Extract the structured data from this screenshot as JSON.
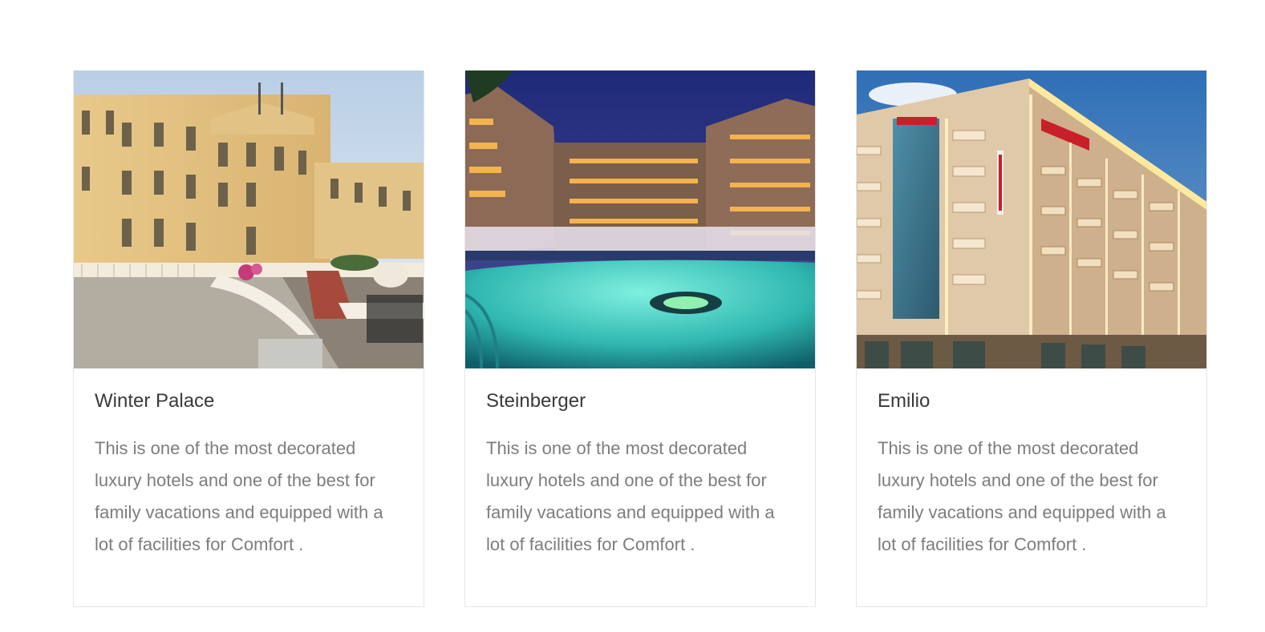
{
  "hotels": [
    {
      "name": "Winter Palace",
      "description": "This is one of the most decorated luxury hotels and one of the best for family vacations and equipped with a lot of facilities for Comfort ."
    },
    {
      "name": "Steinberger",
      "description": "This is one of the most decorated luxury hotels and one of the best for family vacations and equipped with a lot of facilities for Comfort ."
    },
    {
      "name": "Emilio",
      "description": "This is one of the most decorated luxury hotels and one of the best for family vacations and equipped with a lot of facilities for Comfort ."
    }
  ]
}
